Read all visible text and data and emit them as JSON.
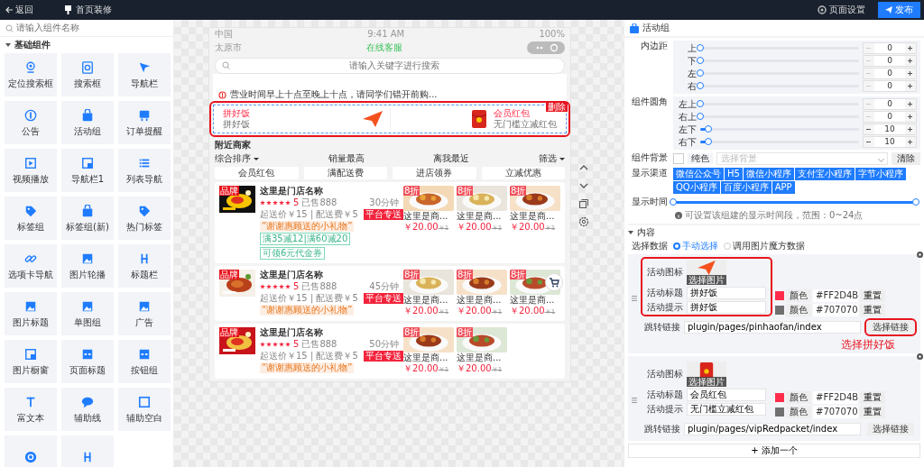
{
  "topbar": {
    "back": "返回",
    "page_title": "首页装修",
    "settings": "页面设置",
    "publish": "发布"
  },
  "components": {
    "search": {
      "placeholder": "请输入组件名称"
    },
    "group": {
      "title": "基础组件",
      "expanded": true,
      "items": [
        {
          "kind": "full",
          "label": "定位搜索框"
        },
        {
          "kind": "full",
          "label": "搜索框"
        },
        {
          "kind": "full",
          "label": "导航栏"
        },
        {
          "kind": "full",
          "label": "公告"
        },
        {
          "kind": "full",
          "label": "活动组"
        },
        {
          "kind": "full",
          "label": "订单提醒"
        },
        {
          "kind": "full",
          "label": "视频播放"
        },
        {
          "kind": "full",
          "label": "导航栏1"
        },
        {
          "kind": "full",
          "label": "列表导航"
        },
        {
          "kind": "full",
          "label": "标签组"
        },
        {
          "kind": "full",
          "label": "标签组(新)"
        },
        {
          "kind": "full",
          "label": "热门标签"
        },
        {
          "kind": "full",
          "label": "选项卡导航"
        },
        {
          "kind": "full",
          "label": "图片轮播"
        },
        {
          "kind": "full",
          "label": "标题栏"
        },
        {
          "kind": "full",
          "label": "图片标题"
        },
        {
          "kind": "full",
          "label": "单图组"
        },
        {
          "kind": "full",
          "label": "广告"
        },
        {
          "kind": "full",
          "label": "图片橱窗"
        },
        {
          "kind": "full",
          "label": "页面标题"
        },
        {
          "kind": "full",
          "label": "按钮组"
        },
        {
          "kind": "full",
          "label": "富文本"
        },
        {
          "kind": "full",
          "label": "辅助线"
        },
        {
          "kind": "full",
          "label": "辅助空白"
        },
        {
          "kind": "cut"
        },
        {
          "kind": "cut"
        }
      ]
    }
  },
  "phone": {
    "status": {
      "carrier": "中国",
      "time": "9:41 AM",
      "battery": "100%"
    },
    "nav": {
      "city": "太原市",
      "service": "在线客服"
    },
    "search": {
      "placeholder": "请输入关键字进行搜索"
    },
    "notice": "营业时间早上十点至晚上十点，请同学们错开前购...",
    "activity": {
      "highlighted": true,
      "badge": "删除",
      "items": [
        {
          "title": "拼好饭",
          "hint": "拼好饭"
        },
        {
          "title": "会员红包",
          "hint": "无门槛立减红包"
        }
      ]
    },
    "nearby": {
      "title": "附近商家",
      "sorts": [
        {
          "label": "综合排序",
          "dropdown": true
        },
        {
          "label": "销量最高",
          "dropdown": false
        },
        {
          "label": "离我最近",
          "dropdown": false
        },
        {
          "label": "筛选",
          "dropdown": true
        }
      ],
      "tags": [
        "会员红包",
        "满配送费",
        "进店领券",
        "立减优惠"
      ],
      "shops": [
        {
          "brand": "品牌",
          "name": "这里是门店名称",
          "stars": 5,
          "rating": "5",
          "sold": "已售888",
          "time": "30分钟",
          "fees": "起送价￥15 | 配送费￥5",
          "delivery": "平台专送",
          "gift": "“谢谢惠顾送的小礼物”",
          "coupons": [
            "满35减12|满60减20",
            "可领6元代金券"
          ],
          "cart": false,
          "dishes": [
            {
              "badge": "8折",
              "name": "这里是商...",
              "price": "￥20.00",
              "old_price": "￥1"
            },
            {
              "badge": "8折",
              "name": "这里是商...",
              "price": "￥20.00",
              "old_price": "￥1"
            },
            {
              "badge": "8折",
              "name": "这里是商...",
              "price": "￥20.00",
              "old_price": "￥1"
            }
          ]
        },
        {
          "brand": "品牌",
          "name": "这里是门店名称",
          "stars": 5,
          "rating": "5",
          "sold": "已售888",
          "time": "45分钟",
          "fees": "起送价￥15 | 配送费￥5",
          "delivery": "平台专送",
          "gift": "“谢谢惠顾送的小礼物”",
          "cart": true,
          "dishes": [
            {
              "badge": "8折",
              "name": "这里是商...",
              "price": "￥20.00",
              "old_price": "￥1"
            },
            {
              "badge": "8折",
              "name": "这里是商...",
              "price": "￥20.00",
              "old_price": "￥1"
            },
            {
              "badge": "8折",
              "name": "这里是商...",
              "price": "￥20.00",
              "old_price": "￥1"
            }
          ]
        },
        {
          "brand": "品牌",
          "name": "这里是门店名称",
          "stars": 5,
          "rating": "5",
          "sold": "已售888",
          "time": "50分钟",
          "fees": "起送价￥15 | 配送费￥5",
          "delivery": "平台专送",
          "gift": "“谢谢惠顾送的小礼物”",
          "cart": false,
          "dishes": [
            {
              "badge": "8折",
              "name": "这里是商...",
              "price": "￥20.00",
              "old_price": "￥1"
            },
            {
              "badge": "8折",
              "name": "这里是商...",
              "price": "￥20.00",
              "old_price": "￥1"
            }
          ]
        }
      ]
    }
  },
  "panel": {
    "title": "活动组",
    "padding": {
      "label": "内边距",
      "rows": [
        {
          "label": "上",
          "level": 0,
          "value": "0"
        },
        {
          "label": "下",
          "level": 0,
          "value": "0"
        },
        {
          "label": "左",
          "level": 0,
          "value": "0"
        },
        {
          "label": "右",
          "level": 0,
          "value": "0"
        }
      ]
    },
    "radius": {
      "label": "组件圆角",
      "rows": [
        {
          "label": "左上",
          "level": 0,
          "value": "0"
        },
        {
          "label": "右上",
          "level": 0,
          "value": "0"
        },
        {
          "label": "左下",
          "level": 0.05,
          "value": "10"
        },
        {
          "label": "右下",
          "level": 0.05,
          "value": "10"
        }
      ]
    },
    "background": {
      "label": "组件背景",
      "mode": "纯色",
      "placeholder": "选择背景",
      "clear": "清除"
    },
    "channels": {
      "label": "显示渠道",
      "options": [
        {
          "label": "微信公众号",
          "selected": true
        },
        {
          "label": "H5",
          "selected": true
        },
        {
          "label": "微信小程序",
          "selected": true
        },
        {
          "label": "支付宝小程序",
          "selected": true
        },
        {
          "label": "字节小程序",
          "selected": true
        },
        {
          "label": "QQ小程序",
          "selected": true
        },
        {
          "label": "百度小程序",
          "selected": true
        },
        {
          "label": "APP",
          "selected": true
        }
      ]
    },
    "time": {
      "label": "显示时间",
      "level": 1,
      "hint": "可设置该组建的显示时间段，范围：0~24点"
    },
    "content": {
      "title": "内容",
      "expanded": true,
      "source": {
        "label": "选择数据",
        "options": [
          {
            "label": "手动选择",
            "selected": true
          },
          {
            "label": "调用图片魔方数据",
            "selected": false
          }
        ]
      },
      "items": [
        {
          "highlighted": true,
          "icon_label": "活动图标",
          "pick_image": "选择图片",
          "fields": [
            {
              "label": "活动标题",
              "value": "拼好饭",
              "color": "#ff2d4b",
              "color_label": "颜色",
              "hex": "#FF2D4B",
              "reset": "重置"
            },
            {
              "label": "活动提示",
              "value": "拼好饭",
              "color": "#707070",
              "color_label": "颜色",
              "hex": "#707070",
              "reset": "重置"
            }
          ],
          "link": {
            "label": "跳转链接",
            "value": "plugin/pages/pinhaofan/index",
            "button": "选择链接",
            "highlighted": true
          },
          "annotation": "选择拼好饭"
        },
        {
          "highlighted": false,
          "icon_label": "活动图标",
          "pick_image": "选择图片",
          "fields": [
            {
              "label": "活动标题",
              "value": "会员红包",
              "color": "#ff2d4b",
              "color_label": "颜色",
              "hex": "#FF2D4B",
              "reset": "重置"
            },
            {
              "label": "活动提示",
              "value": "无门槛立减红包",
              "color": "#707070",
              "color_label": "颜色",
              "hex": "#707070",
              "reset": "重置"
            }
          ],
          "link": {
            "label": "跳转链接",
            "value": "plugin/pages/vipRedpacket/index",
            "button": "选择链接",
            "highlighted": false
          }
        }
      ],
      "add": "+ 添加一个"
    }
  }
}
